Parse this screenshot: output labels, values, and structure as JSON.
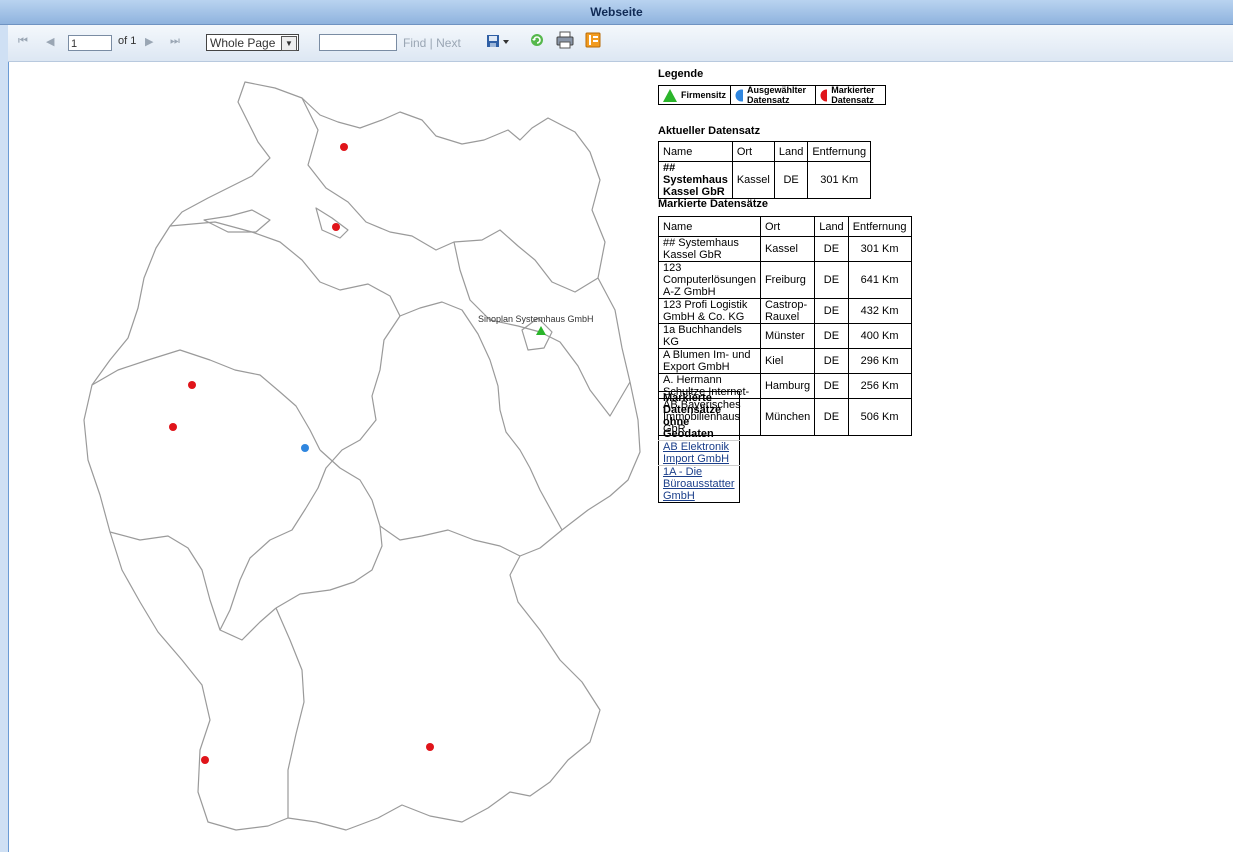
{
  "window": {
    "title": "Webseite"
  },
  "toolbar": {
    "first_page": "⏮",
    "prev_page": "◀",
    "page_value": "1",
    "of_pages": "of 1",
    "next_page": "▶",
    "last_page": "⏭",
    "zoom": "Whole Page",
    "find_value": "",
    "find_label": "Find | Next"
  },
  "map": {
    "hq_label": "Sinoplan Systemhaus GmbH",
    "markers": {
      "hq": "#2bb52b",
      "selected": "#2f86df",
      "marked": "#e0141a"
    }
  },
  "legend": {
    "title": "Legende",
    "items": [
      {
        "label": "Firmensitz",
        "icon": "triangle-icon",
        "color": "#2bb52b"
      },
      {
        "label": "Ausgewählter Datensatz",
        "icon": "circle-icon",
        "color": "#2f86df"
      },
      {
        "label": "Markierter Datensatz",
        "icon": "circle-icon",
        "color": "#e0141a"
      }
    ]
  },
  "current": {
    "title": "Aktueller Datensatz",
    "headers": [
      "Name",
      "Ort",
      "Land",
      "Entfernung"
    ],
    "row": [
      "## Systemhaus Kassel GbR",
      "Kassel",
      "DE",
      "301 Km"
    ]
  },
  "marked": {
    "title": "Markierte Datensätze",
    "headers": [
      "Name",
      "Ort",
      "Land",
      "Entfernung"
    ],
    "rows": [
      [
        "## Systemhaus Kassel GbR",
        "Kassel",
        "DE",
        "301 Km"
      ],
      [
        "123 Computerlösungen A-Z GmbH",
        "Freiburg",
        "DE",
        "641 Km"
      ],
      [
        "123 Profi Logistik GmbH & Co. KG",
        "Castrop-Rauxel",
        "DE",
        "432 Km"
      ],
      [
        "1a Buchhandels KG",
        "Münster",
        "DE",
        "400 Km"
      ],
      [
        "A Blumen Im- und Export GmbH",
        "Kiel",
        "DE",
        "296 Km"
      ],
      [
        "A. Hermann Schultze Internet-",
        "Hamburg",
        "DE",
        "256 Km"
      ],
      [
        "AB Bayerisches Immobilienhaus GbR",
        "München",
        "DE",
        "506 Km"
      ]
    ]
  },
  "nogeo": {
    "title": "Markierte Datensätze ohne Geodaten",
    "links": [
      "AB Elektronik Import GmbH",
      "1A - Die Büroausstatter GmbH"
    ]
  }
}
